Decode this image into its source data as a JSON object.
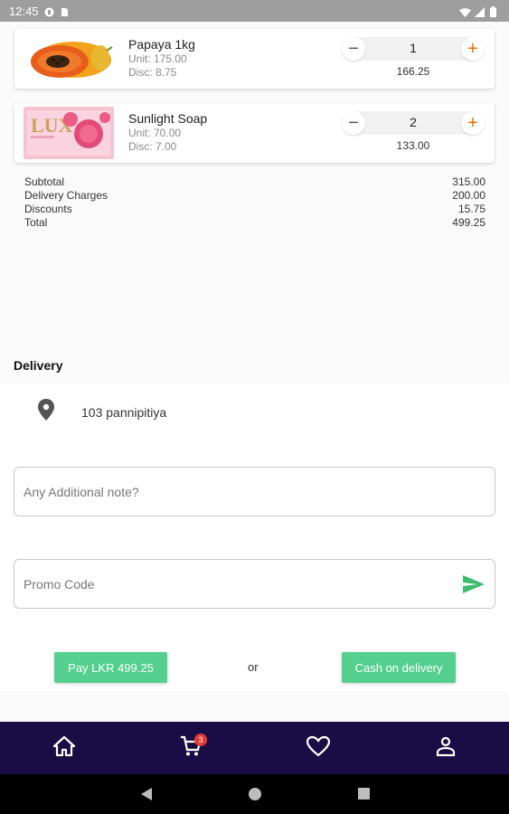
{
  "status_bar": {
    "time": "12:45"
  },
  "cart": {
    "items": [
      {
        "name": "Papaya 1kg",
        "unit": "Unit: 175.00",
        "disc": "Disc: 8.75",
        "qty": "1",
        "line_total": "166.25",
        "qty_minus": "−",
        "qty_plus": "+"
      },
      {
        "name": "Sunlight Soap",
        "unit": "Unit: 70.00",
        "disc": "Disc: 7.00",
        "qty": "2",
        "line_total": "133.00",
        "qty_minus": "−",
        "qty_plus": "+"
      }
    ]
  },
  "summary": {
    "rows": [
      {
        "label": "Subtotal",
        "value": "315.00"
      },
      {
        "label": "Delivery Charges",
        "value": "200.00"
      },
      {
        "label": "Discounts",
        "value": "15.75"
      },
      {
        "label": "Total",
        "value": "499.25"
      }
    ]
  },
  "delivery": {
    "title": "Delivery",
    "address": "103 pannipitiya",
    "note_placeholder": "Any Additional note?",
    "promo_placeholder": "Promo Code"
  },
  "payment": {
    "pay_label": "Pay  LKR 499.25",
    "or_label": "or",
    "cod_label": "Cash on delivery"
  },
  "bottom_nav": {
    "cart_badge": "3",
    "icons": [
      "home-icon",
      "cart-icon",
      "heart-icon",
      "person-icon"
    ]
  },
  "colors": {
    "accent_green": "#54cf8e",
    "nav_bg": "#1a0d45",
    "plus_orange": "#ef6c00",
    "badge_red": "#e53935"
  }
}
